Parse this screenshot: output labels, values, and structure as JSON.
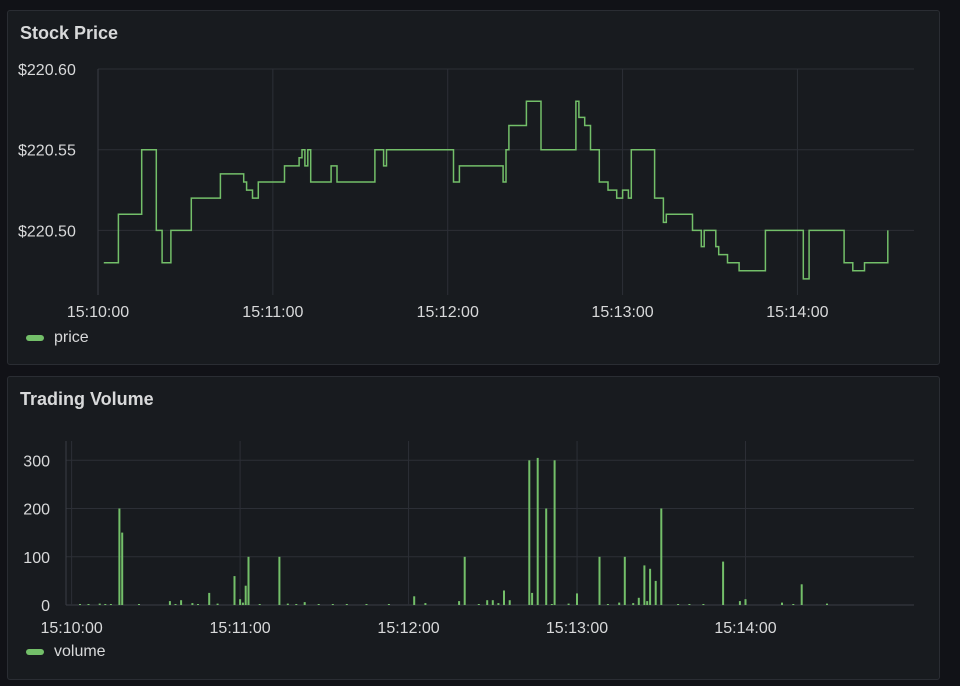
{
  "colors": {
    "series": "#73bf69",
    "grid": "#2c2f36",
    "axis": "#3a3d44"
  },
  "chart_data": [
    {
      "type": "line",
      "title": "Stock Price",
      "legend": "bottom-left",
      "grid": true,
      "xlim": [
        "15:10:00",
        "15:14:40"
      ],
      "ylim": [
        220.46,
        220.6
      ],
      "x_ticks": [
        "15:10:00",
        "15:11:00",
        "15:12:00",
        "15:13:00",
        "15:14:00"
      ],
      "y_ticks": [
        "$220.50",
        "$220.55",
        "$220.60"
      ],
      "y_tick_values": [
        220.5,
        220.55,
        220.6
      ],
      "series": [
        {
          "name": "price",
          "color": "#73bf69",
          "step": true,
          "points": [
            [
              "15:10:02",
              220.48
            ],
            [
              "15:10:07",
              220.51
            ],
            [
              "15:10:15",
              220.55
            ],
            [
              "15:10:20",
              220.5
            ],
            [
              "15:10:22",
              220.48
            ],
            [
              "15:10:25",
              220.5
            ],
            [
              "15:10:32",
              220.52
            ],
            [
              "15:10:42",
              220.535
            ],
            [
              "15:10:50",
              220.53
            ],
            [
              "15:10:51",
              220.525
            ],
            [
              "15:10:53",
              220.52
            ],
            [
              "15:10:55",
              220.53
            ],
            [
              "15:11:04",
              220.54
            ],
            [
              "15:11:09",
              220.545
            ],
            [
              "15:11:10",
              220.55
            ],
            [
              "15:11:11",
              220.54
            ],
            [
              "15:11:12",
              220.55
            ],
            [
              "15:11:13",
              220.53
            ],
            [
              "15:11:20",
              220.54
            ],
            [
              "15:11:22",
              220.53
            ],
            [
              "15:11:35",
              220.55
            ],
            [
              "15:11:38",
              220.54
            ],
            [
              "15:11:39",
              220.55
            ],
            [
              "15:12:00",
              220.55
            ],
            [
              "15:12:02",
              220.53
            ],
            [
              "15:12:04",
              220.54
            ],
            [
              "15:12:19",
              220.53
            ],
            [
              "15:12:20",
              220.55
            ],
            [
              "15:12:21",
              220.565
            ],
            [
              "15:12:27",
              220.58
            ],
            [
              "15:12:32",
              220.55
            ],
            [
              "15:12:44",
              220.58
            ],
            [
              "15:12:45",
              220.57
            ],
            [
              "15:12:47",
              220.565
            ],
            [
              "15:12:49",
              220.55
            ],
            [
              "15:12:52",
              220.53
            ],
            [
              "15:12:55",
              220.525
            ],
            [
              "15:12:58",
              220.52
            ],
            [
              "15:13:00",
              220.525
            ],
            [
              "15:13:02",
              220.52
            ],
            [
              "15:13:03",
              220.55
            ],
            [
              "15:13:11",
              220.52
            ],
            [
              "15:13:14",
              220.505
            ],
            [
              "15:13:15",
              220.51
            ],
            [
              "15:13:24",
              220.5
            ],
            [
              "15:13:27",
              220.49
            ],
            [
              "15:13:28",
              220.5
            ],
            [
              "15:13:32",
              220.49
            ],
            [
              "15:13:33",
              220.485
            ],
            [
              "15:13:36",
              220.48
            ],
            [
              "15:13:40",
              220.475
            ],
            [
              "15:13:49",
              220.5
            ],
            [
              "15:14:02",
              220.47
            ],
            [
              "15:14:04",
              220.5
            ],
            [
              "15:14:16",
              220.48
            ],
            [
              "15:14:19",
              220.475
            ],
            [
              "15:14:23",
              220.48
            ],
            [
              "15:14:31",
              220.5
            ]
          ]
        }
      ]
    },
    {
      "type": "bar",
      "title": "Trading Volume",
      "legend": "bottom-left",
      "grid": true,
      "xlim": [
        "15:09:58",
        "15:15:00"
      ],
      "ylim": [
        0,
        340
      ],
      "x_ticks": [
        "15:10:00",
        "15:11:00",
        "15:12:00",
        "15:13:00",
        "15:14:00"
      ],
      "y_ticks": [
        "0",
        "100",
        "200",
        "300"
      ],
      "y_tick_values": [
        0,
        100,
        200,
        300
      ],
      "series": [
        {
          "name": "volume",
          "color": "#73bf69",
          "points": [
            [
              "15:10:03",
              1
            ],
            [
              "15:10:06",
              1
            ],
            [
              "15:10:10",
              3
            ],
            [
              "15:10:12",
              2
            ],
            [
              "15:10:14",
              1
            ],
            [
              "15:10:17",
              200
            ],
            [
              "15:10:18",
              150
            ],
            [
              "15:10:24",
              1
            ],
            [
              "15:10:35",
              8
            ],
            [
              "15:10:37",
              2
            ],
            [
              "15:10:39",
              10
            ],
            [
              "15:10:43",
              4
            ],
            [
              "15:10:45",
              1
            ],
            [
              "15:10:49",
              25
            ],
            [
              "15:10:52",
              3
            ],
            [
              "15:10:58",
              60
            ],
            [
              "15:11:00",
              12
            ],
            [
              "15:11:01",
              5
            ],
            [
              "15:11:02",
              40
            ],
            [
              "15:11:03",
              100
            ],
            [
              "15:11:07",
              2
            ],
            [
              "15:11:14",
              100
            ],
            [
              "15:11:17",
              3
            ],
            [
              "15:11:20",
              1
            ],
            [
              "15:11:23",
              6
            ],
            [
              "15:11:28",
              2
            ],
            [
              "15:11:33",
              1
            ],
            [
              "15:11:38",
              1
            ],
            [
              "15:11:45",
              2
            ],
            [
              "15:11:53",
              2
            ],
            [
              "15:12:02",
              18
            ],
            [
              "15:12:06",
              4
            ],
            [
              "15:12:18",
              8
            ],
            [
              "15:12:20",
              100
            ],
            [
              "15:12:25",
              1
            ],
            [
              "15:12:28",
              10
            ],
            [
              "15:12:30",
              10
            ],
            [
              "15:12:32",
              4
            ],
            [
              "15:12:34",
              30
            ],
            [
              "15:12:36",
              10
            ],
            [
              "15:12:43",
              300
            ],
            [
              "15:12:44",
              25
            ],
            [
              "15:12:46",
              305
            ],
            [
              "15:12:49",
              200
            ],
            [
              "15:12:51",
              1
            ],
            [
              "15:12:52",
              300
            ],
            [
              "15:12:57",
              3
            ],
            [
              "15:13:00",
              24
            ],
            [
              "15:13:08",
              100
            ],
            [
              "15:13:11",
              2
            ],
            [
              "15:13:15",
              5
            ],
            [
              "15:13:17",
              100
            ],
            [
              "15:13:20",
              4
            ],
            [
              "15:13:22",
              15
            ],
            [
              "15:13:24",
              82
            ],
            [
              "15:13:25",
              8
            ],
            [
              "15:13:26",
              75
            ],
            [
              "15:13:28",
              50
            ],
            [
              "15:13:30",
              200
            ],
            [
              "15:13:36",
              2
            ],
            [
              "15:13:40",
              1
            ],
            [
              "15:13:45",
              2
            ],
            [
              "15:13:52",
              90
            ],
            [
              "15:13:58",
              8
            ],
            [
              "15:14:00",
              12
            ],
            [
              "15:14:13",
              5
            ],
            [
              "15:14:17",
              2
            ],
            [
              "15:14:20",
              43
            ],
            [
              "15:14:29",
              3
            ]
          ]
        }
      ]
    }
  ],
  "price_panel": {
    "title": "Stock Price",
    "legend_label": "price"
  },
  "volume_panel": {
    "title": "Trading Volume",
    "legend_label": "volume"
  }
}
